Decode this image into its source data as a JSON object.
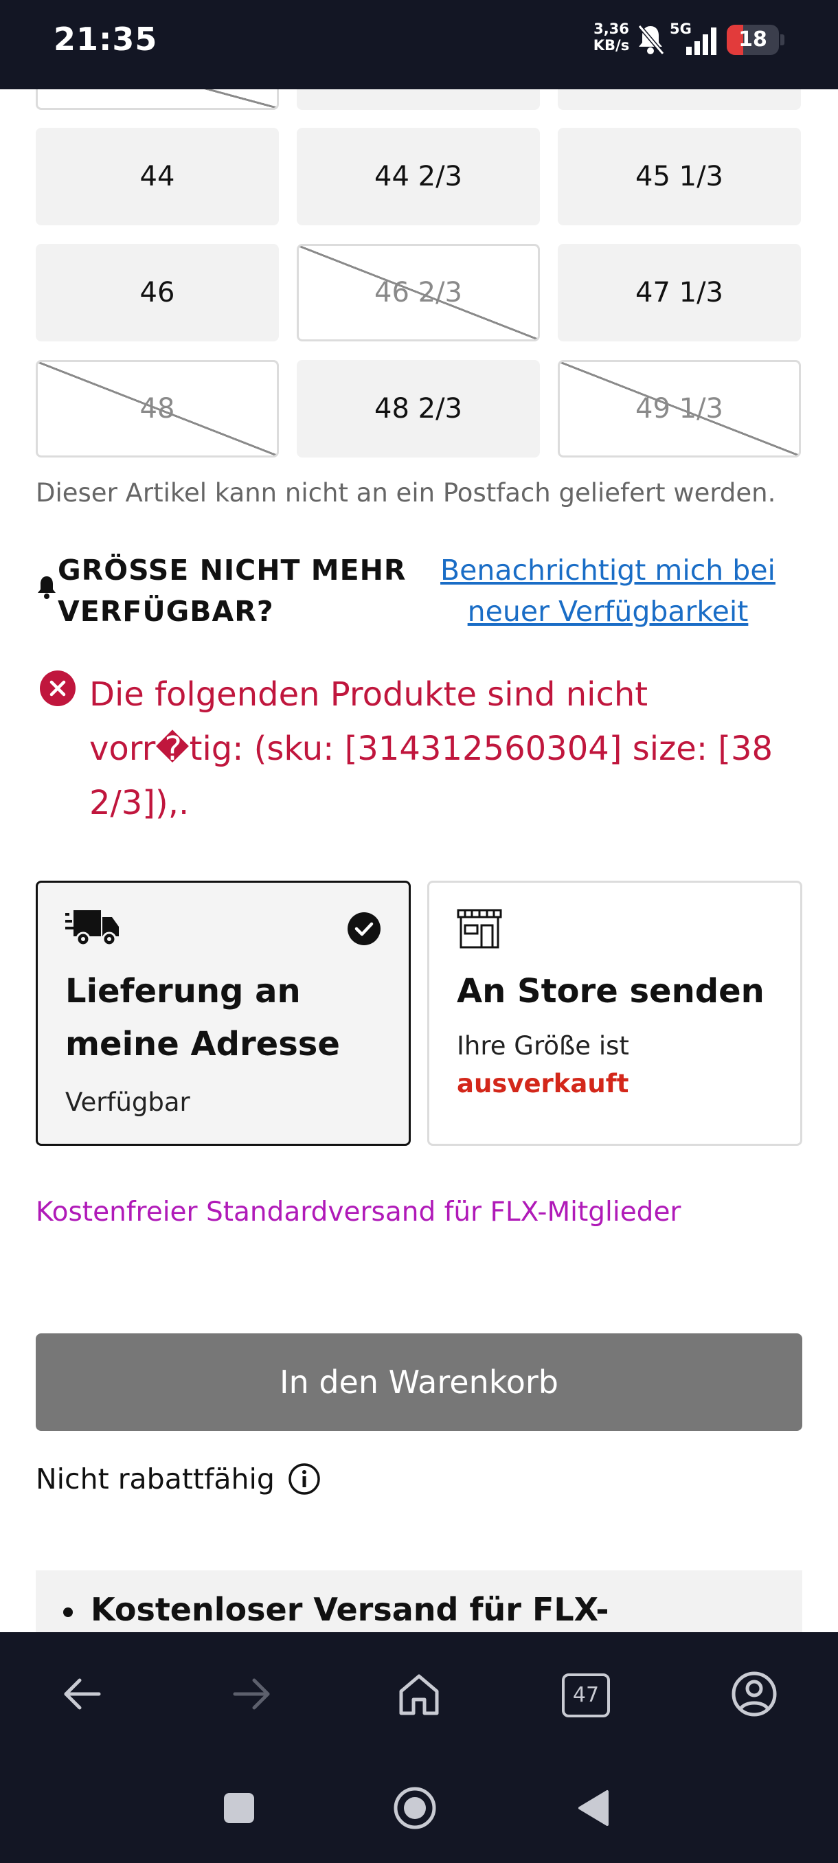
{
  "status_bar": {
    "time": "21:35",
    "speed_value": "3,36",
    "speed_unit": "KB/s",
    "network": "5G",
    "battery": "18",
    "battery_color": "#e23b3b"
  },
  "sizes": [
    {
      "label": "",
      "available": false
    },
    {
      "label": "",
      "available": true
    },
    {
      "label": "",
      "available": true
    },
    {
      "label": "44",
      "available": true
    },
    {
      "label": "44 2/3",
      "available": true
    },
    {
      "label": "45 1/3",
      "available": true
    },
    {
      "label": "46",
      "available": true
    },
    {
      "label": "46 2/3",
      "available": false
    },
    {
      "label": "47 1/3",
      "available": true
    },
    {
      "label": "48",
      "available": false
    },
    {
      "label": "48 2/3",
      "available": true
    },
    {
      "label": "49 1/3",
      "available": false
    }
  ],
  "postbox_note": "Dieser Artikel kann nicht an ein Postfach geliefert werden.",
  "notify": {
    "title": "GRÖSSE NICHT MEHR VERFÜGBAR?",
    "link": "Benachrichtigt mich bei neuer Verfügbarkeit"
  },
  "error": {
    "message": "Die folgenden Produkte sind nicht vorr�tig: (sku: [314312560304] size: [38 2/3]),.",
    "color": "#c0163d"
  },
  "delivery_options": {
    "home": {
      "title": "Lieferung an meine Adresse",
      "status": "Verfügbar",
      "icon": "truck-icon",
      "selected": true
    },
    "store": {
      "title": "An Store senden",
      "status_prefix": "Ihre Größe ist",
      "status_value": "ausverkauft",
      "icon": "store-icon",
      "selected": false
    }
  },
  "free_shipping": "Kostenfreier Standardversand für FLX-Mitglieder",
  "cart_button": "In den Warenkorb",
  "not_discountable": "Nicht rabattfähig",
  "benefits": [
    "Kostenloser Versand für FLX-"
  ],
  "browser": {
    "tabs_count": "47",
    "icons": [
      "back-arrow-icon",
      "forward-arrow-icon",
      "home-icon",
      "tabs-icon",
      "account-icon"
    ]
  },
  "android_nav": {
    "icons": [
      "recents-icon",
      "home-circle-icon",
      "back-triangle-icon"
    ]
  }
}
